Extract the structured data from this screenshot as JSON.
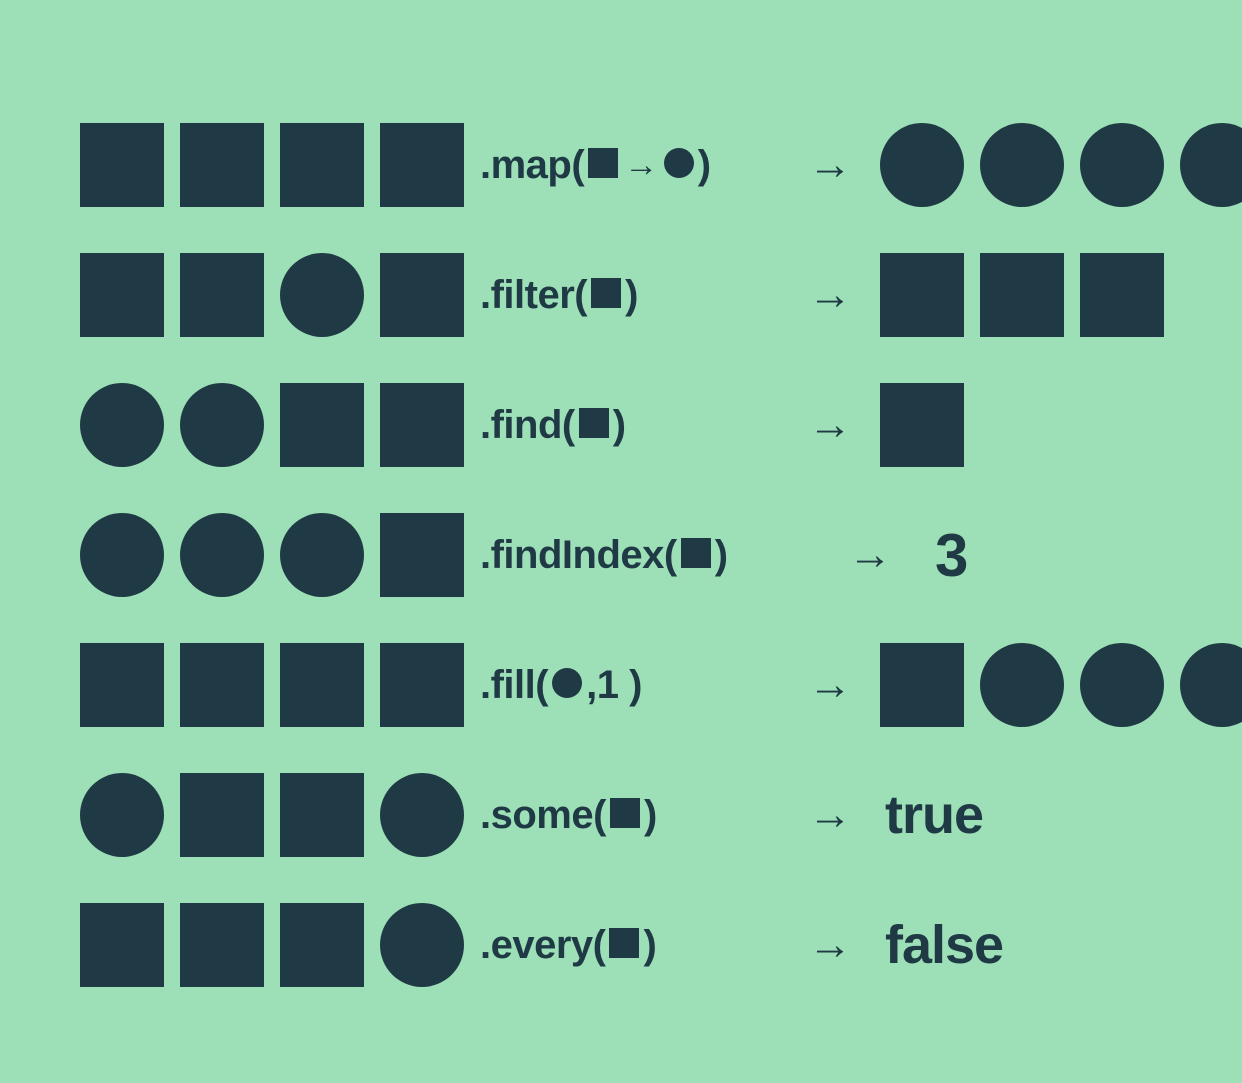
{
  "colors": {
    "bg": "#9de0b7",
    "shape": "#1f3a45"
  },
  "arrow_glyph": "→",
  "rows": [
    {
      "input": [
        "square",
        "square",
        "square",
        "square"
      ],
      "method": {
        "prefix": ".map(",
        "args": [
          "square",
          "arrow",
          "circle"
        ],
        "suffix": ")"
      },
      "output_type": "shapes",
      "output": [
        "circle",
        "circle",
        "circle",
        "circle"
      ]
    },
    {
      "input": [
        "square",
        "square",
        "circle",
        "square"
      ],
      "method": {
        "prefix": ".filter(",
        "args": [
          "square"
        ],
        "suffix": ")"
      },
      "output_type": "shapes",
      "output": [
        "square",
        "square",
        "square"
      ]
    },
    {
      "input": [
        "circle",
        "circle",
        "square",
        "square"
      ],
      "method": {
        "prefix": ".find(",
        "args": [
          "square"
        ],
        "suffix": ")"
      },
      "output_type": "shapes",
      "output": [
        "square"
      ]
    },
    {
      "input": [
        "circle",
        "circle",
        "circle",
        "square"
      ],
      "method": {
        "prefix": ".findIndex(",
        "args": [
          "square"
        ],
        "suffix": ")"
      },
      "output_type": "number",
      "output_text": "3",
      "arrow_offset": true
    },
    {
      "input": [
        "square",
        "square",
        "square",
        "square"
      ],
      "method": {
        "prefix": ".fill(",
        "args": [
          "circle"
        ],
        "suffix": ",1 )"
      },
      "output_type": "shapes",
      "output": [
        "square",
        "circle",
        "circle",
        "circle"
      ]
    },
    {
      "input": [
        "circle",
        "square",
        "square",
        "circle"
      ],
      "method": {
        "prefix": ".some(",
        "args": [
          "square"
        ],
        "suffix": ")"
      },
      "output_type": "text",
      "output_text": "true"
    },
    {
      "input": [
        "square",
        "square",
        "square",
        "circle"
      ],
      "method": {
        "prefix": ".every(",
        "args": [
          "square"
        ],
        "suffix": ")"
      },
      "output_type": "text",
      "output_text": "false"
    }
  ]
}
